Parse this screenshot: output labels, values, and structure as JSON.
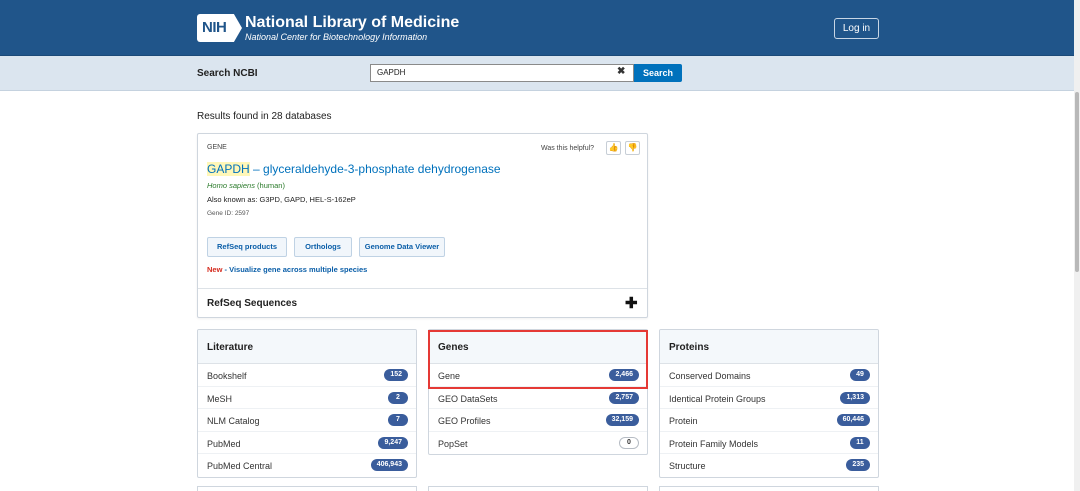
{
  "header": {
    "logo_text": "NIH",
    "title": "National Library of Medicine",
    "subtitle": "National Center for Biotechnology Information",
    "login_label": "Log in"
  },
  "search": {
    "label": "Search NCBI",
    "value": "GAPDH",
    "clear_glyph": "✖",
    "button_label": "Search"
  },
  "results_text": "Results found in 28 databases",
  "gene_card": {
    "category": "GENE",
    "helpful_prompt": "Was this helpful?",
    "thumbs_up_glyph": "👍",
    "thumbs_down_glyph": "👎",
    "symbol": "GAPDH",
    "separator": " – ",
    "name": "glyceraldehyde-3-phosphate dehydrogenase",
    "species": "Homo sapiens",
    "common_name": " (human)",
    "aliases": "Also known as: G3PD, GAPD, HEL-S-162eP",
    "gene_id": "Gene ID: 2597",
    "buttons": [
      "RefSeq products",
      "Orthologs",
      "Genome Data Viewer"
    ],
    "new_label": "New",
    "new_text": " - Visualize gene across multiple species",
    "refseq_label": "RefSeq Sequences",
    "expand_glyph": "✚"
  },
  "databases": [
    {
      "title": "Literature",
      "rows": [
        {
          "label": "Bookshelf",
          "count": "152"
        },
        {
          "label": "MeSH",
          "count": "2"
        },
        {
          "label": "NLM Catalog",
          "count": "7"
        },
        {
          "label": "PubMed",
          "count": "9,247"
        },
        {
          "label": "PubMed Central",
          "count": "406,943"
        }
      ]
    },
    {
      "title": "Genes",
      "rows": [
        {
          "label": "Gene",
          "count": "2,466"
        },
        {
          "label": "GEO DataSets",
          "count": "2,757"
        },
        {
          "label": "GEO Profiles",
          "count": "32,159"
        },
        {
          "label": "PopSet",
          "count": "0"
        }
      ]
    },
    {
      "title": "Proteins",
      "rows": [
        {
          "label": "Conserved Domains",
          "count": "49"
        },
        {
          "label": "Identical Protein Groups",
          "count": "1,313"
        },
        {
          "label": "Protein",
          "count": "60,446"
        },
        {
          "label": "Protein Family Models",
          "count": "11"
        },
        {
          "label": "Structure",
          "count": "235"
        }
      ]
    }
  ],
  "colors": {
    "header_bg": "#20558a",
    "search_bg": "#dbe5ef",
    "link_blue": "#0071bc",
    "badge_bg": "#3a5d9c",
    "highlight_border": "#e53935"
  }
}
